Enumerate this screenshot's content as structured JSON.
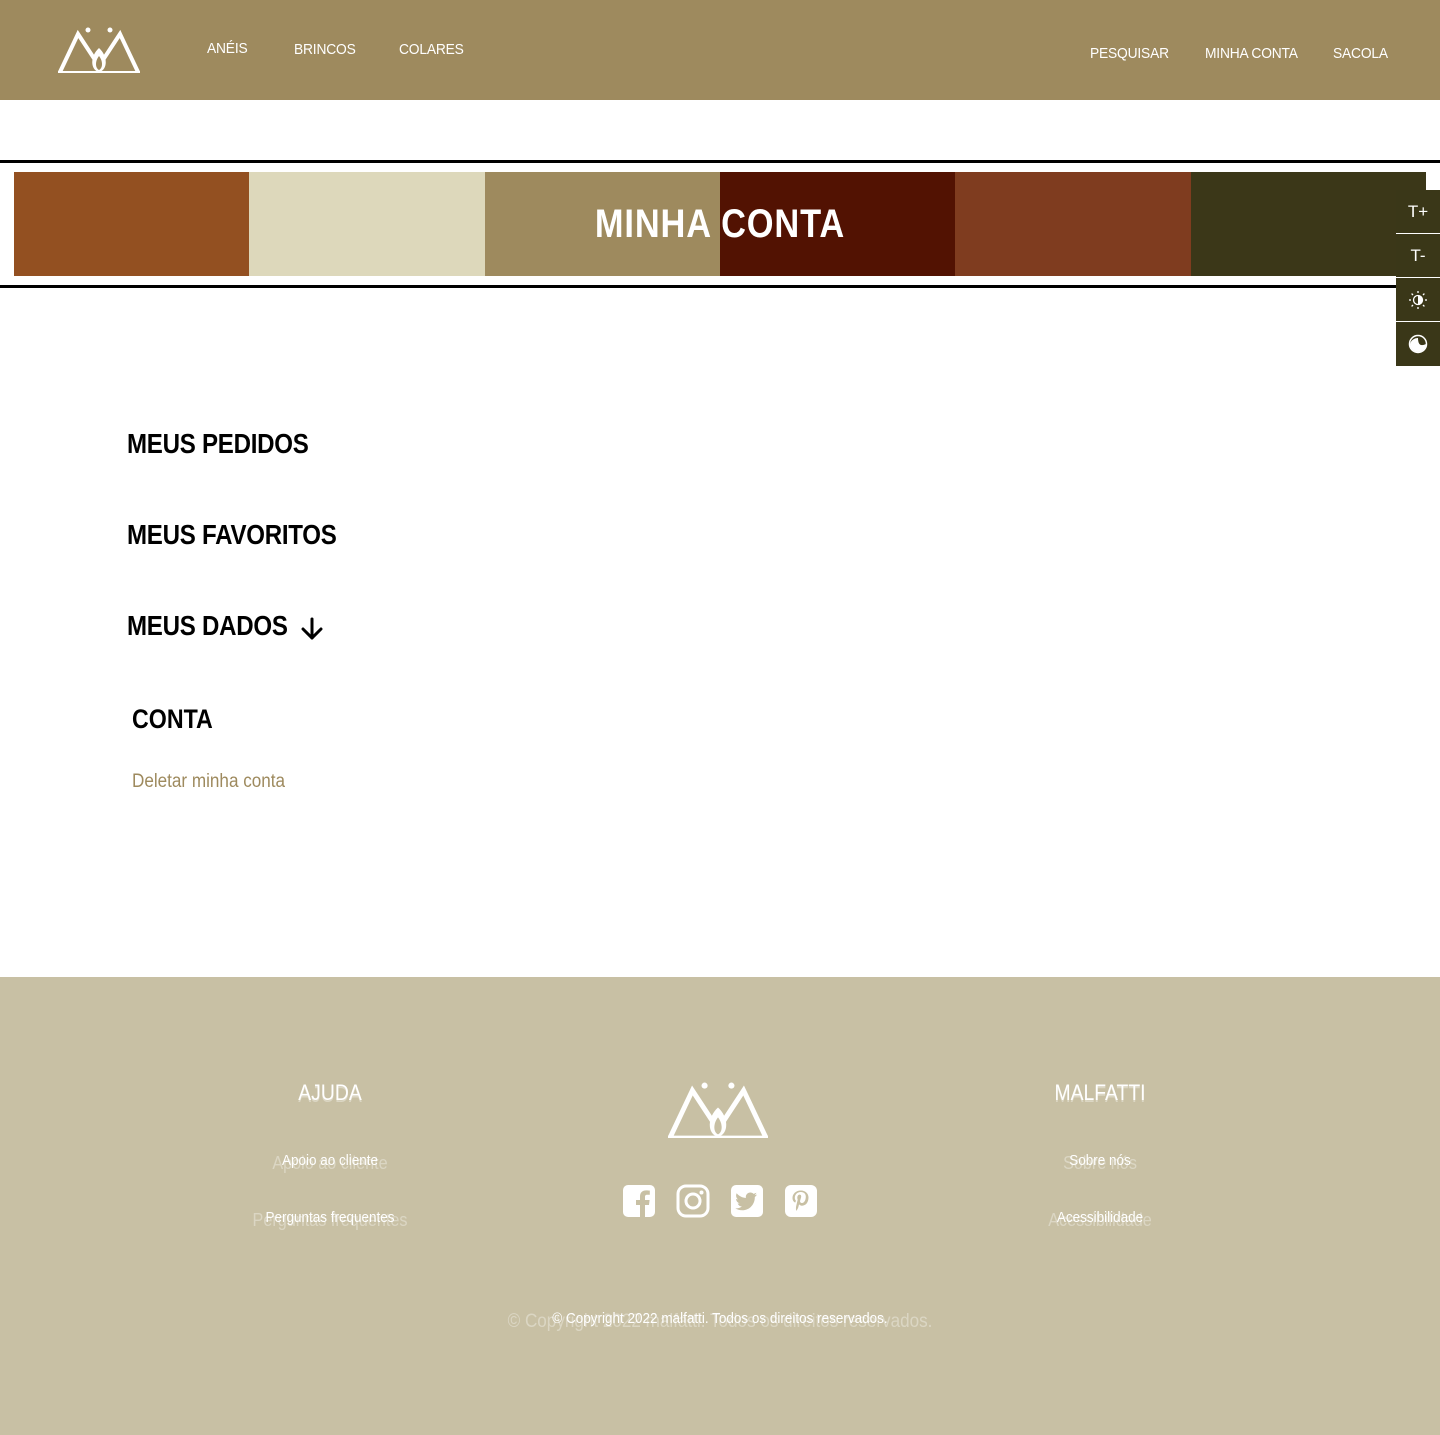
{
  "header": {
    "nav_left": [
      {
        "label": "ANÉIS"
      },
      {
        "label": "BRINCOS"
      },
      {
        "label": "COLARES"
      }
    ],
    "nav_right": [
      {
        "label": "PESQUISAR"
      },
      {
        "label": "MINHA CONTA"
      },
      {
        "label": "SACOLA"
      }
    ]
  },
  "banner": {
    "title": "MINHA CONTA",
    "swatches": [
      "#935021",
      "#ddd8bb",
      "#9e8a5e",
      "#521202",
      "#7f3c1f",
      "#3b3718"
    ]
  },
  "a11y": {
    "increase_label": "T+",
    "decrease_label": "T-"
  },
  "account": {
    "orders_label": "MEUS PEDIDOS",
    "favorites_label": "MEUS FAVORITOS",
    "data_label": "MEUS DADOS",
    "section_title": "CONTA",
    "delete_label": "Deletar minha conta"
  },
  "footer": {
    "help": {
      "title": "AJUDA",
      "links": [
        "Apoio ao cliente",
        "Perguntas frequentes"
      ]
    },
    "brand": {
      "title": "MALFATTI",
      "links": [
        "Sobre nós",
        "Acessibilidade"
      ]
    },
    "copyright": "© Copyright 2022 malfatti. Todos os direitos reservados."
  },
  "colors": {
    "header_bg": "#9e8a5e",
    "footer_bg": "#c8c0a4",
    "a11y_bg": "#3a3718",
    "link": "#9e8a5e"
  }
}
